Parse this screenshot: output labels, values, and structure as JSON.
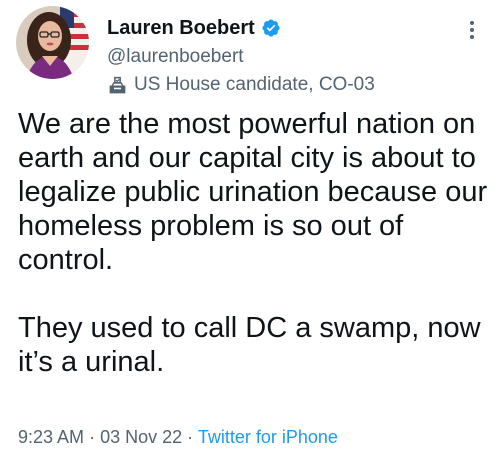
{
  "author": {
    "display_name": "Lauren Boebert",
    "handle": "@laurenboebert",
    "label": "US House candidate, CO-03",
    "avatar_icon": "profile-photo",
    "verified_icon": "verified-badge-icon",
    "label_icon": "ballot-box-icon"
  },
  "tweet": {
    "paragraph_1": "We are the most powerful nation on earth and our capital city is about to legalize public urination because our homeless problem is so out of control.",
    "paragraph_2": "They used to call DC a swamp, now it’s a urinal.",
    "time": "9:23 AM",
    "separator": "·",
    "date": "03 Nov 22",
    "source": "Twitter for iPhone"
  },
  "colors": {
    "text_primary": "#0f1419",
    "text_secondary": "#536471",
    "accent": "#1d9bf0"
  }
}
